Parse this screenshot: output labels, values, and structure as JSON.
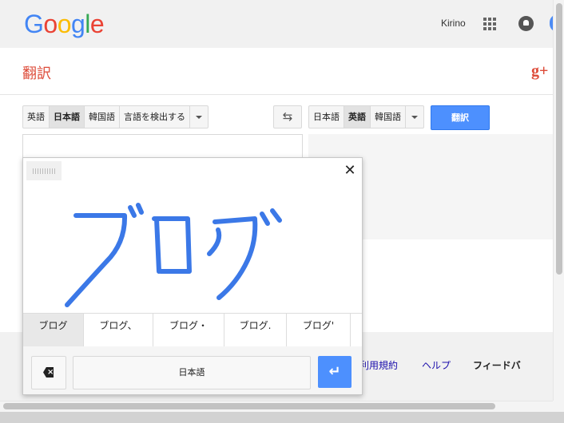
{
  "header": {
    "logo": "Google",
    "logo_colors": [
      "#4285f4",
      "#ea4335",
      "#fbbc05",
      "#4285f4",
      "#34a853",
      "#ea4335"
    ],
    "user_name": "Kirino",
    "apps_icon": "apps-grid-icon",
    "notifications_icon": "bell-icon"
  },
  "page": {
    "title": "翻訳",
    "gplus": "g+"
  },
  "source_languages": [
    {
      "label": "英語",
      "selected": false
    },
    {
      "label": "日本語",
      "selected": true
    },
    {
      "label": "韓国語",
      "selected": false
    },
    {
      "label": "言語を検出する",
      "selected": false
    }
  ],
  "swap_icon": "swap-arrows-icon",
  "target_languages": [
    {
      "label": "日本語",
      "selected": false
    },
    {
      "label": "英語",
      "selected": true
    },
    {
      "label": "韓国語",
      "selected": false
    }
  ],
  "translate_button": "翻訳",
  "handwriting": {
    "drawn_text": "ブログ",
    "candidates": [
      "ブログ",
      "ブログ、",
      "ブログ・",
      "ブログ.",
      "ブログ'"
    ],
    "language": "日本語",
    "close_icon": "close-icon",
    "backspace_icon": "backspace-icon",
    "enter_icon": "enter-icon"
  },
  "footer": {
    "links": [
      "利用規約",
      "ヘルプ"
    ],
    "feedback": "フィードバ"
  },
  "colors": {
    "accent": "#4d90fe",
    "title_red": "#dd4b39",
    "ink_blue": "#3b78e7"
  }
}
